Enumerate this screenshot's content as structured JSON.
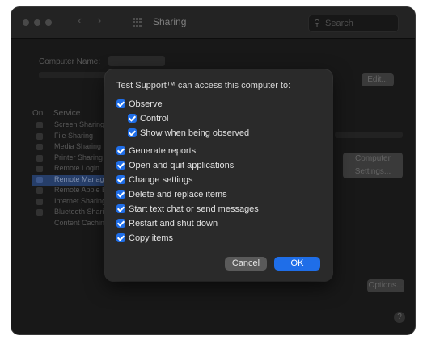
{
  "window": {
    "title": "Sharing",
    "search_placeholder": "Search"
  },
  "background": {
    "computer_name_label": "Computer Name:",
    "edit_label": "Edit...",
    "on_header": "On",
    "service_header": "Service",
    "services": [
      "Screen Sharing",
      "File Sharing",
      "Media Sharing",
      "Printer Sharing",
      "Remote Login",
      "Remote Management",
      "Remote Apple Events",
      "Internet Sharing",
      "Bluetooth Sharing",
      "Content Caching"
    ],
    "computer_settings_label": "Computer Settings...",
    "options_label": "Options..."
  },
  "dialog": {
    "heading": "Test Support™ can access this computer to:",
    "options": [
      {
        "label": "Observe",
        "checked": true,
        "indent": 0
      },
      {
        "label": "Control",
        "checked": true,
        "indent": 1
      },
      {
        "label": "Show when being observed",
        "checked": true,
        "indent": 1
      },
      {
        "label": "Generate reports",
        "checked": true,
        "indent": 0
      },
      {
        "label": "Open and quit applications",
        "checked": true,
        "indent": 0
      },
      {
        "label": "Change settings",
        "checked": true,
        "indent": 0
      },
      {
        "label": "Delete and replace items",
        "checked": true,
        "indent": 0
      },
      {
        "label": "Start text chat or send messages",
        "checked": true,
        "indent": 0
      },
      {
        "label": "Restart and shut down",
        "checked": true,
        "indent": 0
      },
      {
        "label": "Copy items",
        "checked": true,
        "indent": 0
      }
    ],
    "cancel_label": "Cancel",
    "ok_label": "OK"
  },
  "colors": {
    "accent": "#1f6ee8",
    "window_bg": "#1e1e1e",
    "sheet_bg": "#2a2a2a"
  },
  "icons": [
    "close-icon",
    "minimize-icon",
    "zoom-icon",
    "back-icon",
    "forward-icon",
    "grid-icon",
    "search-icon",
    "checkbox-icon",
    "help-icon"
  ]
}
